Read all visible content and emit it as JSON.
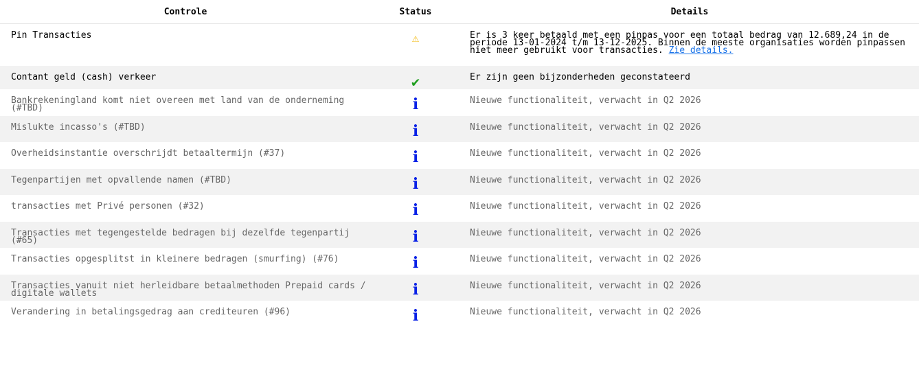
{
  "headers": {
    "controle": "Controle",
    "status": "Status",
    "details": "Details"
  },
  "colors": {
    "warning": "#f2b600",
    "ok": "#1e9e1e",
    "info": "#0a22e6",
    "link": "#1a73e8",
    "muted_text": "#666666"
  },
  "rows": [
    {
      "controle": "Pin Transacties",
      "status_icon": "warning-icon",
      "details": "Er is 3 keer betaald met een pinpas voor een totaal bedrag van 12.689,24 in de periode 13-01-2024 t/m 13-12-2025. Binnen de meeste organisaties worden pinpassen niet meer gebruikt voor transacties.",
      "link": "Zie details."
    },
    {
      "controle": "Contant geld (cash) verkeer",
      "status_icon": "check-icon",
      "details": "Er zijn geen bijzonderheden geconstateerd"
    },
    {
      "controle": "Bankrekeningland komt niet overeen met land van de onderneming (#TBD)",
      "status_icon": "info-icon",
      "details": "Nieuwe functionaliteit, verwacht in Q2 2026"
    },
    {
      "controle": "Mislukte incasso's (#TBD)",
      "status_icon": "info-icon",
      "details": "Nieuwe functionaliteit, verwacht in Q2 2026"
    },
    {
      "controle": "Overheidsinstantie overschrijdt betaaltermijn (#37)",
      "status_icon": "info-icon",
      "details": "Nieuwe functionaliteit, verwacht in Q2 2026"
    },
    {
      "controle": "Tegenpartijen met opvallende namen (#TBD)",
      "status_icon": "info-icon",
      "details": "Nieuwe functionaliteit, verwacht in Q2 2026"
    },
    {
      "controle": "transacties met Privé personen (#32)",
      "status_icon": "info-icon",
      "details": "Nieuwe functionaliteit, verwacht in Q2 2026"
    },
    {
      "controle": "Transacties met tegengestelde bedragen bij dezelfde tegenpartij (#65)",
      "status_icon": "info-icon",
      "details": "Nieuwe functionaliteit, verwacht in Q2 2026"
    },
    {
      "controle": "Transacties opgesplitst in kleinere bedragen (smurfing) (#76)",
      "status_icon": "info-icon",
      "details": "Nieuwe functionaliteit, verwacht in Q2 2026"
    },
    {
      "controle": "Transacties vanuit niet herleidbare betaalmethoden Prepaid cards / digitale wallets",
      "status_icon": "info-icon",
      "details": "Nieuwe functionaliteit, verwacht in Q2 2026"
    },
    {
      "controle": "Verandering in betalingsgedrag aan crediteuren (#96)",
      "status_icon": "info-icon",
      "details": "Nieuwe functionaliteit, verwacht in Q2 2026"
    }
  ]
}
